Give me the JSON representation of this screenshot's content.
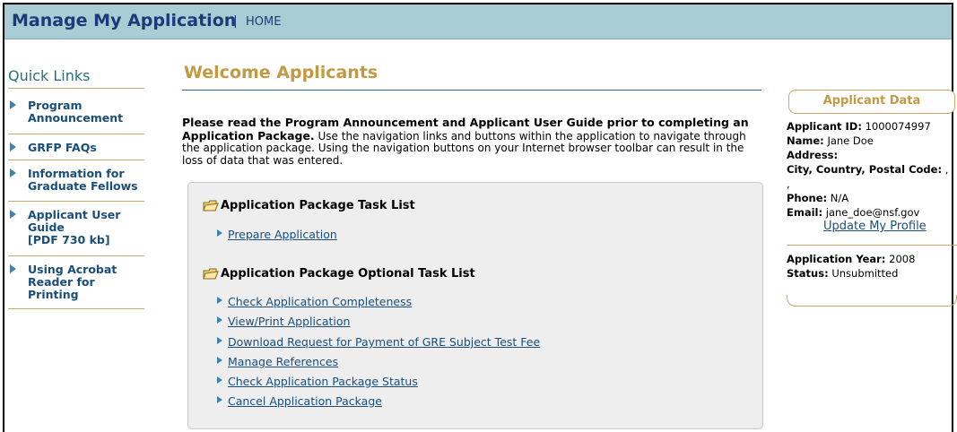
{
  "header": {
    "app_title": "Manage My Application",
    "separator": "|",
    "home_link": "HOME"
  },
  "quick_links": {
    "title": "Quick Links",
    "items": [
      {
        "label": "Program\nAnnouncement"
      },
      {
        "label": "GRFP FAQs"
      },
      {
        "label": "Information for\nGraduate Fellows"
      },
      {
        "label": "Applicant User\nGuide\n[PDF 730 kb]"
      },
      {
        "label": "Using Acrobat\nReader for\nPrinting"
      }
    ]
  },
  "main": {
    "welcome_title": "Welcome Applicants",
    "intro_bold": "Please read the Program Announcement and Applicant User Guide prior to completing an Application Package.",
    "intro_text": " Use the navigation links and buttons within the application to navigate through the application package. Using the navigation buttons on your Internet browser toolbar can result in the loss of data that was entered.",
    "task_list": {
      "header": "Application Package Task List",
      "links": [
        "Prepare Application"
      ]
    },
    "optional_task_list": {
      "header": "Application Package Optional Task List",
      "links": [
        "Check Application Completeness",
        "View/Print Application",
        "Download Request for Payment of GRE Subject Test Fee",
        "Manage References",
        "Check Application Package Status",
        "Cancel Application Package"
      ]
    }
  },
  "applicant_data": {
    "title": "Applicant Data",
    "applicant_id_label": "Applicant ID:",
    "applicant_id": "1000074997",
    "name_label": "Name:",
    "name": "Jane Doe",
    "address_label": "Address:",
    "city_label": "City, Country, Postal Code:",
    "city_value": ", ,",
    "phone_label": "Phone:",
    "phone": "N/A",
    "email_label": "Email:",
    "email": "jane_doe@nsf.gov",
    "update_link": "Update My Profile",
    "app_year_label": "Application Year:",
    "app_year": "2008",
    "status_label": "Status:",
    "status": "Unsubmitted"
  }
}
